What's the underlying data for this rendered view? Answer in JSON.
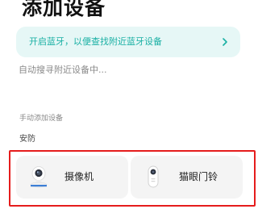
{
  "header": {
    "title": "添加设备"
  },
  "bluetooth_banner": {
    "text": "开启蓝牙，以便查找附近蓝牙设备",
    "icon": "chevron-right-icon",
    "accent_color": "#19b0a4",
    "background_color": "#e6f7f6"
  },
  "scan": {
    "status_text": "自动搜寻附近设备中..."
  },
  "manual_add": {
    "section_title": "手动添加设备",
    "category": "安防",
    "devices": [
      {
        "label": "摄像机",
        "icon": "security-camera-icon"
      },
      {
        "label": "猫眼门铃",
        "icon": "peephole-doorbell-icon"
      }
    ],
    "highlight_color": "#e51c1c"
  }
}
